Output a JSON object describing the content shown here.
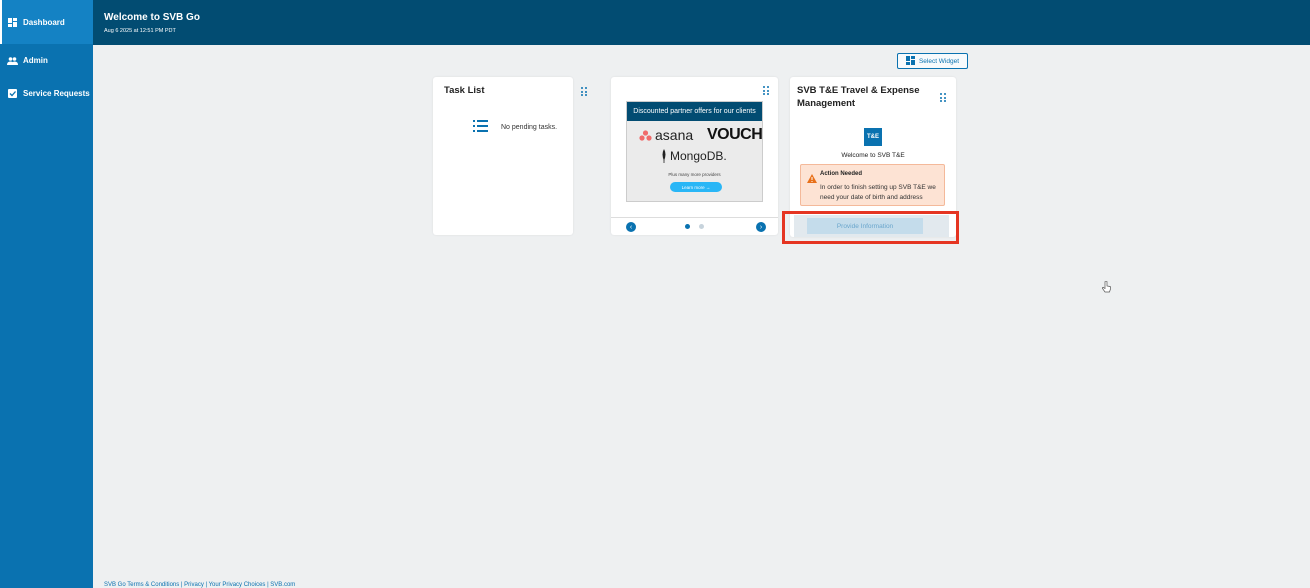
{
  "sidebar": {
    "items": [
      {
        "label": "Dashboard",
        "icon": "dashboard-icon",
        "active": true
      },
      {
        "label": "Admin",
        "icon": "people-icon",
        "active": false
      },
      {
        "label": "Service Requests",
        "icon": "checkbox-icon",
        "active": false
      }
    ]
  },
  "header": {
    "title": "Welcome to SVB Go",
    "subtitle": "Aug 6 2025 at 12:51 PM PDT"
  },
  "toolbar": {
    "select_widget_label": "Select Widget"
  },
  "task_list": {
    "title": "Task List",
    "empty_text": "No pending tasks."
  },
  "promo": {
    "header": "Discounted partner offers for our clients",
    "partners": [
      "asana",
      "VOUCH",
      "MongoDB."
    ],
    "more_text": "Plus many more providers",
    "button_label": "Learn more →"
  },
  "te_card": {
    "title": "SVB T&E Travel & Expense Management",
    "logo_text": "T&E",
    "welcome": "Welcome to SVB T&E",
    "alert_title": "Action Needed",
    "alert_text": "In order to finish setting up SVB T&E we need your date of birth and address",
    "button_label": "Provide Information"
  },
  "footer": {
    "text": "SVB Go Terms & Conditions | Privacy | Your Privacy Choices | SVB.com"
  },
  "colors": {
    "sidebar": "#0a72b0",
    "header": "#024c72",
    "highlight": "#e53522",
    "alert_bg": "#fde3d4"
  }
}
